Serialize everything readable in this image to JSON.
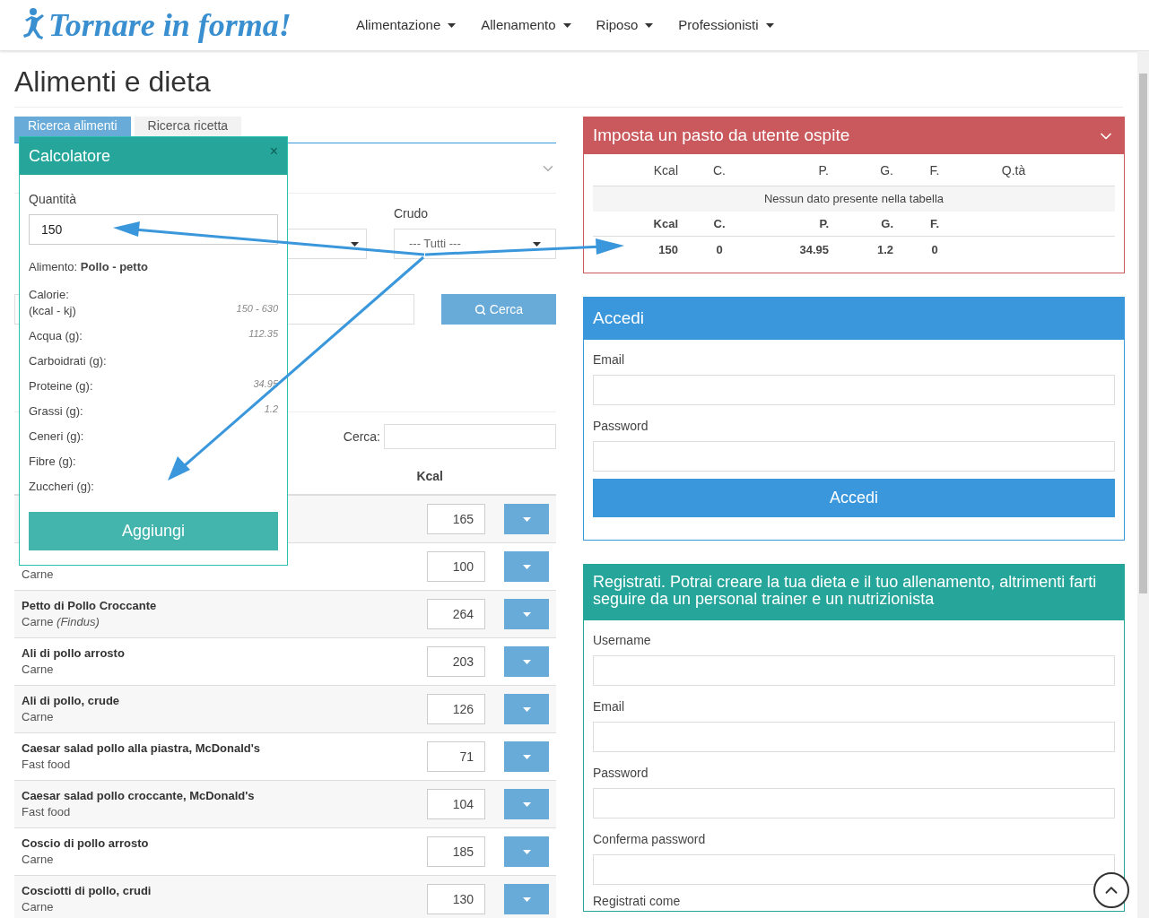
{
  "header": {
    "logo": "Tornare in forma!",
    "nav": [
      {
        "label": "Alimentazione"
      },
      {
        "label": "Allenamento"
      },
      {
        "label": "Riposo"
      },
      {
        "label": "Professionisti"
      }
    ]
  },
  "page_title": "Alimenti e dieta",
  "search": {
    "tabs": [
      {
        "label": "Ricerca alimenti",
        "selected": true
      },
      {
        "label": "Ricerca ricetta",
        "selected": false
      }
    ],
    "crudo_label": "Crudo",
    "crudo_value": "--- Tutti ---",
    "search_button": "Cerca",
    "table_search_label": "Cerca:",
    "kcal_header": "Kcal",
    "rows": [
      {
        "kcal": "165"
      },
      {
        "category": "Carne",
        "kcal": "100"
      },
      {
        "name": "Petto di Pollo Croccante",
        "category": "Carne",
        "brand": "(Findus)",
        "kcal": "264"
      },
      {
        "name": "Ali di pollo arrosto",
        "category": "Carne",
        "kcal": "203"
      },
      {
        "name": "Ali di pollo, crude",
        "category": "Carne",
        "kcal": "126"
      },
      {
        "name": "Caesar salad pollo alla piastra, McDonald's",
        "category": "Fast food",
        "kcal": "71"
      },
      {
        "name": "Caesar salad pollo croccante, McDonald's",
        "category": "Fast food",
        "kcal": "104"
      },
      {
        "name": "Coscio di pollo arrosto",
        "category": "Carne",
        "kcal": "185"
      },
      {
        "name": "Cosciotti di pollo, crudi",
        "category": "Carne",
        "kcal": "130"
      }
    ]
  },
  "calculator": {
    "title": "Calcolatore",
    "close": "×",
    "quantity_label": "Quantità",
    "quantity_value": "150",
    "food": "Alimento: **Pollo - petto**",
    "nutrients": [
      {
        "label": "Calorie:",
        "unit": "(kcal - kj)",
        "value": "150 - 630"
      },
      {
        "label": "Acqua (g):",
        "value": "112.35"
      },
      {
        "label": "Carboidrati (g):"
      },
      {
        "label": "Proteine (g):",
        "value": "34.95"
      },
      {
        "label": "Grassi (g):",
        "value": "1.2"
      },
      {
        "label": "Ceneri (g):"
      },
      {
        "label": "Fibre (g):"
      },
      {
        "label": "Zuccheri (g):"
      }
    ],
    "add_button": "Aggiungi"
  },
  "meal_panel": {
    "title": "Imposta un pasto da utente ospite",
    "columns": [
      "Kcal",
      "C.",
      "P.",
      "G.",
      "F.",
      "Q.tà"
    ],
    "empty": "Nessun dato presente nella tabella",
    "total_columns": [
      "Kcal",
      "C.",
      "P.",
      "G.",
      "F."
    ],
    "totals": [
      "150",
      "0",
      "34.95",
      "1.2",
      "0"
    ]
  },
  "login": {
    "title": "Accedi",
    "fields": [
      "Email",
      "Password"
    ],
    "button": "Accedi"
  },
  "register": {
    "title": "Registrati. Potrai creare la tua dieta e il tuo allenamento, altrimenti farti seguire da un personal trainer e un nutrizionista",
    "fields": [
      "Username",
      "Email",
      "Password",
      "Conferma password"
    ],
    "role_label": "Registrati come"
  }
}
